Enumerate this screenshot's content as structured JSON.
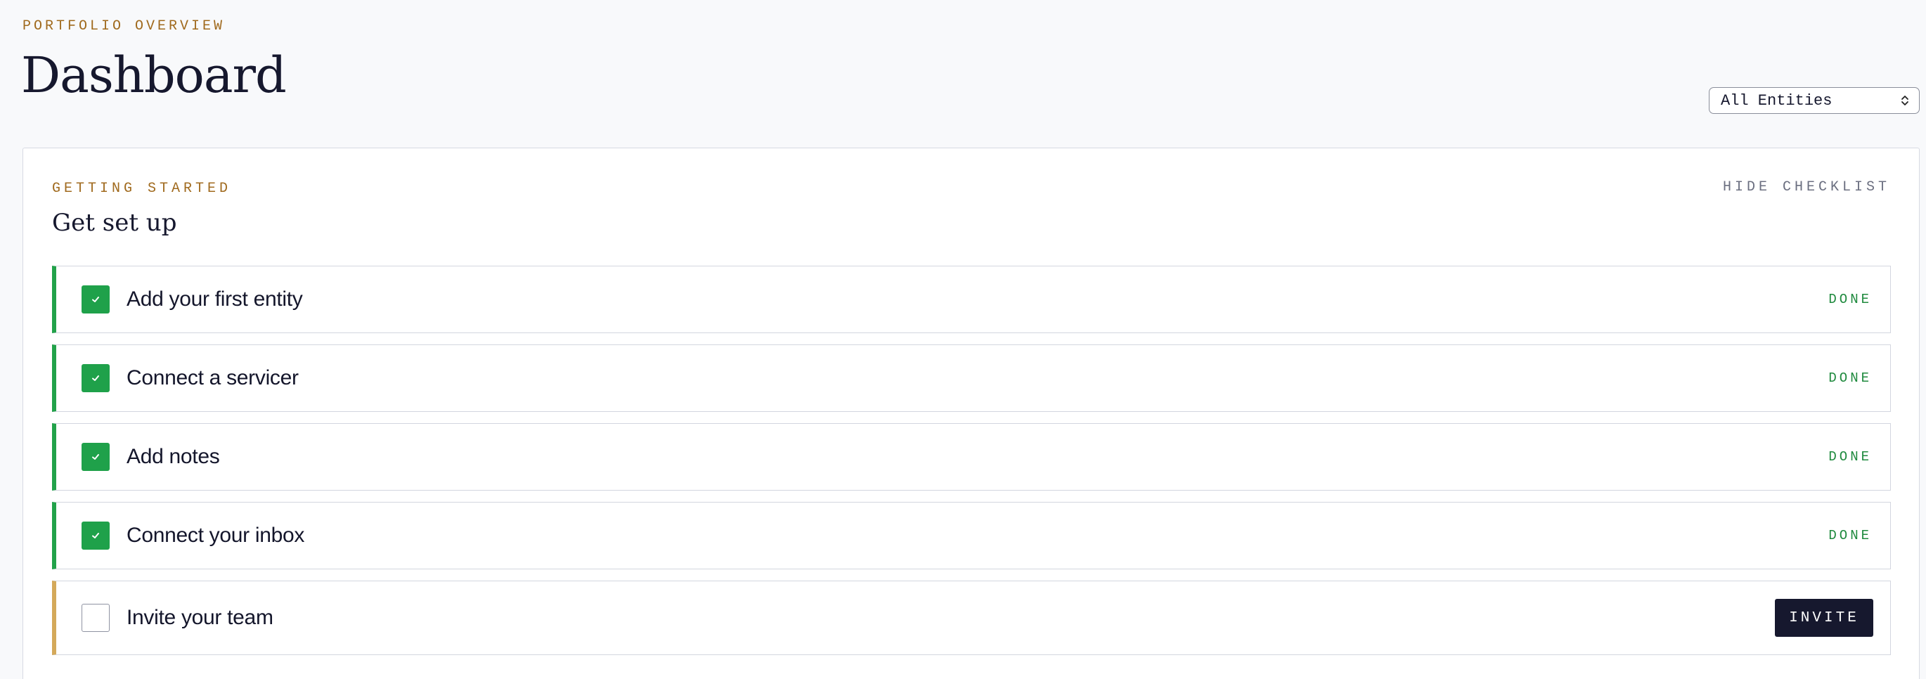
{
  "header": {
    "eyebrow": "PORTFOLIO OVERVIEW",
    "title": "Dashboard",
    "entity_select": {
      "value": "All Entities"
    }
  },
  "checklist": {
    "eyebrow": "GETTING STARTED",
    "title": "Get set up",
    "hide_label": "HIDE CHECKLIST",
    "items": [
      {
        "label": "Add your first entity",
        "status": "DONE",
        "done": true
      },
      {
        "label": "Connect a servicer",
        "status": "DONE",
        "done": true
      },
      {
        "label": "Add notes",
        "status": "DONE",
        "done": true
      },
      {
        "label": "Connect your inbox",
        "status": "DONE",
        "done": true
      },
      {
        "label": "Invite your team",
        "action": "INVITE",
        "done": false
      }
    ]
  },
  "colors": {
    "accent_gold": "#a06a1e",
    "success_green": "#1fa14a",
    "pending_border": "#d4a95a",
    "primary_dark": "#16182e"
  },
  "icons": {
    "check": "check-icon",
    "select_chevron": "chevron-up-down-icon"
  }
}
